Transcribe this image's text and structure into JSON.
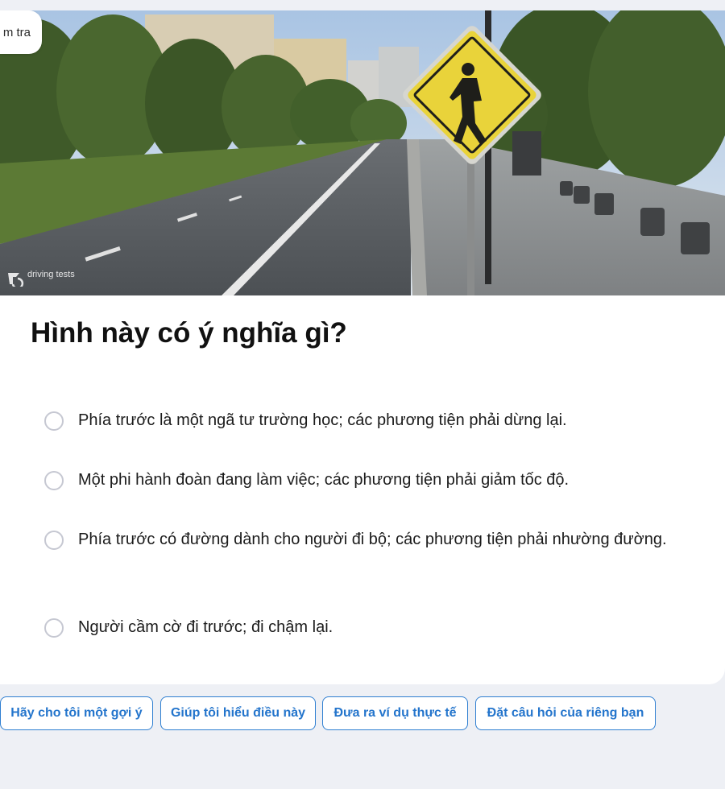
{
  "breadcrumb": {
    "label": "m tra"
  },
  "image": {
    "watermark": "driving tests"
  },
  "question": {
    "title": "Hình này có ý nghĩa gì?"
  },
  "options": [
    {
      "label": "Phía trước là một ngã tư trường học; các phương tiện phải dừng lại."
    },
    {
      "label": "Một phi hành đoàn đang làm việc; các phương tiện phải giảm tốc độ."
    },
    {
      "label": "Phía trước có đường dành cho người đi bộ; các phương tiện phải nhường đường."
    },
    {
      "label": "Người cầm cờ đi trước; đi chậm lại."
    }
  ],
  "actions": [
    {
      "label": "Hãy cho tôi một gợi ý"
    },
    {
      "label": "Giúp tôi hiểu điều này"
    },
    {
      "label": "Đưa ra ví dụ thực tế"
    },
    {
      "label": "Đặt câu hỏi của riêng bạn"
    }
  ],
  "colors": {
    "accent": "#2f7fd1",
    "sign_yellow": "#e9d33a",
    "background": "#eef0f5"
  }
}
